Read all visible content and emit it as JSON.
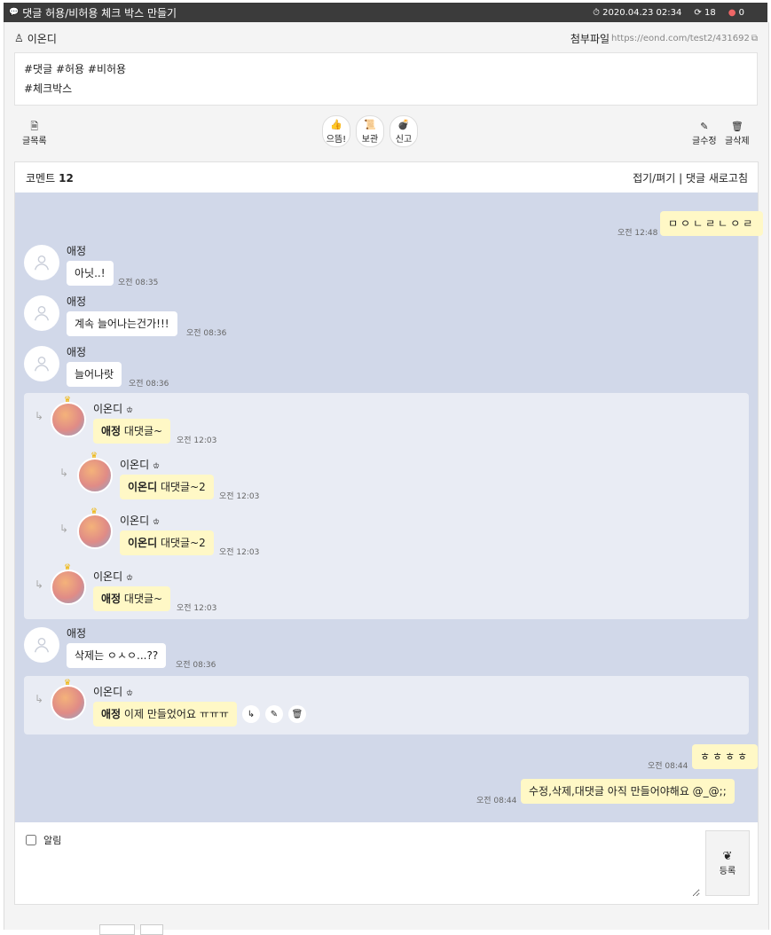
{
  "title_bar": {
    "title": "댓글 허용/비허용 체크 박스 만들기",
    "date": "2020.04.23 02:34",
    "views": "18",
    "likes": "0"
  },
  "post": {
    "author": "이온디",
    "attach_label": "첨부파일",
    "url": "https://eond.com/test2/431692",
    "tags": [
      "#댓글 #허용 #비허용",
      "#체크박스"
    ]
  },
  "toolbar": {
    "list": "글목록",
    "upvote": "으뜸!",
    "save": "보관",
    "report": "신고",
    "edit": "글수정",
    "delete": "글삭제"
  },
  "comments": {
    "label": "코멘트",
    "count": "12",
    "actions": "접기/펴기 | 댓글 새로고침",
    "items": [
      {
        "author": "",
        "text": "ㅁㅇㄴㄹㄴㅇㄹ",
        "time": "오전 12:48"
      },
      {
        "author": "애정",
        "text": "아닛..!",
        "time": "오전 08:35"
      },
      {
        "author": "애정",
        "text": "계속 늘어나는건가!!!",
        "time": "오전 08:36"
      },
      {
        "author": "애정",
        "text": "늘어나랏",
        "time": "오전 08:36"
      },
      {
        "author": "이온디",
        "mention": "애정",
        "text": "대댓글~",
        "time": "오전 12:03"
      },
      {
        "author": "이온디",
        "mention": "이온디",
        "text": "대댓글~2",
        "time": "오전 12:03"
      },
      {
        "author": "이온디",
        "mention": "이온디",
        "text": "대댓글~2",
        "time": "오전 12:03"
      },
      {
        "author": "이온디",
        "mention": "애정",
        "text": "대댓글~",
        "time": "오전 12:03"
      },
      {
        "author": "애정",
        "text": "삭제는 ㅇㅅㅇ...??",
        "time": "오전 08:36"
      },
      {
        "author": "이온디",
        "mention": "애정",
        "text": "이제 만들었어요 ㅠㅠㅠ",
        "time": ""
      },
      {
        "author": "",
        "text": "ㅎㅎㅎㅎ",
        "time": "오전 08:44"
      },
      {
        "author": "",
        "text": "수정,삭제,대댓글 아직 만들어야해요 @_@;;",
        "time": "오전 08:44"
      }
    ]
  },
  "write": {
    "notify_label": "알림",
    "submit_label": "등록"
  }
}
